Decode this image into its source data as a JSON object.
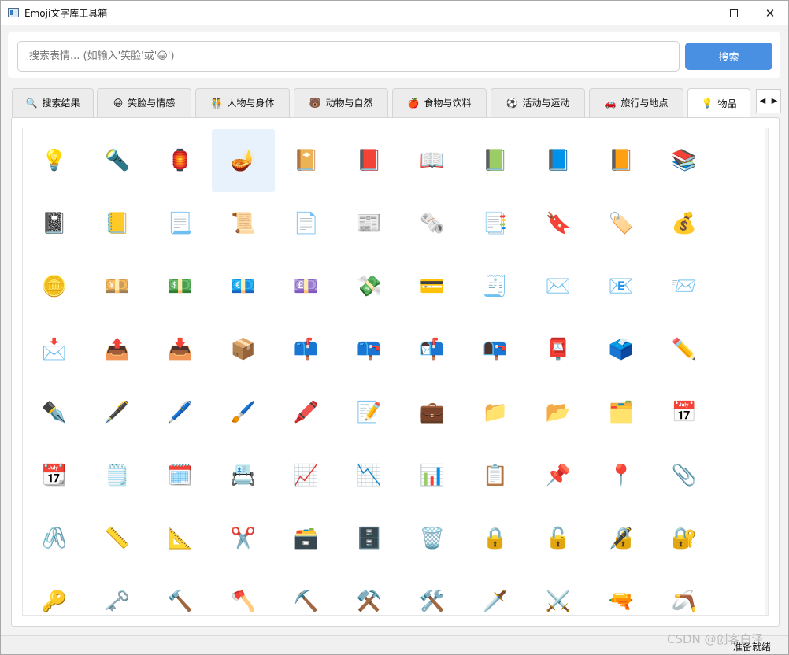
{
  "window": {
    "title": "Emoji文字库工具箱",
    "min": "—",
    "max": "☐",
    "close": "✕"
  },
  "search": {
    "placeholder": "搜索表情... (如输入'笑脸'或'😀')",
    "button": "搜索"
  },
  "tabs": [
    {
      "icon": "🔍",
      "label": "搜索结果"
    },
    {
      "icon": "😀",
      "label": "笑脸与情感"
    },
    {
      "icon": "🧑‍🤝‍🧑",
      "label": "人物与身体"
    },
    {
      "icon": "🐻",
      "label": "动物与自然"
    },
    {
      "icon": "🍎",
      "label": "食物与饮料"
    },
    {
      "icon": "⚽",
      "label": "活动与运动"
    },
    {
      "icon": "🚗",
      "label": "旅行与地点"
    },
    {
      "icon": "💡",
      "label": "物品"
    }
  ],
  "active_tab": "物品",
  "tab_scroll": {
    "left": "◀",
    "right": "▶"
  },
  "emojis": [
    "💡",
    "🔦",
    "🏮",
    "🪔",
    "📔",
    "📕",
    "📖",
    "📗",
    "📘",
    "📙",
    "📚",
    "📓",
    "📒",
    "📃",
    "📜",
    "📄",
    "📰",
    "🗞️",
    "📑",
    "🔖",
    "🏷️",
    "💰",
    "🪙",
    "💴",
    "💵",
    "💶",
    "💷",
    "💸",
    "💳",
    "🧾",
    "✉️",
    "📧",
    "📨",
    "📩",
    "📤",
    "📥",
    "📦",
    "📫",
    "📪",
    "📬",
    "📭",
    "📮",
    "🗳️",
    "✏️",
    "✒️",
    "🖋️",
    "🖊️",
    "🖌️",
    "🖍️",
    "📝",
    "💼",
    "📁",
    "📂",
    "🗂️",
    "📅",
    "📆",
    "🗒️",
    "🗓️",
    "📇",
    "📈",
    "📉",
    "📊",
    "📋",
    "📌",
    "📍",
    "📎",
    "🖇️",
    "📏",
    "📐",
    "✂️",
    "🗃️",
    "🗄️",
    "🗑️",
    "🔒",
    "🔓",
    "🔏",
    "🔐",
    "🔑",
    "🗝️",
    "🔨",
    "🪓",
    "⛏️",
    "⚒️",
    "🛠️",
    "🗡️",
    "⚔️",
    "🔫",
    "🪃"
  ],
  "selected_emoji": "🪔",
  "status": "准备就绪",
  "watermark": "CSDN @创客白泽"
}
